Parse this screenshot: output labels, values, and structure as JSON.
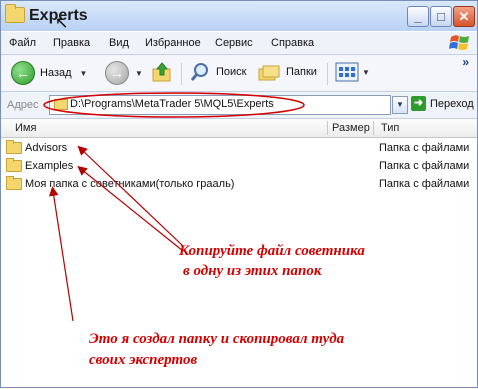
{
  "window": {
    "title": "Experts"
  },
  "menu": [
    "Файл",
    "Правка",
    "Вид",
    "Избранное",
    "Сервис",
    "Справка"
  ],
  "toolbar": {
    "back_label": "Назад",
    "search_label": "Поиск",
    "folders_label": "Папки"
  },
  "address": {
    "label": "Адрес",
    "value": "D:\\Programs\\MetaTrader 5\\MQL5\\Experts",
    "go_label": "Переход"
  },
  "columns": {
    "name": "Имя",
    "size": "Размер",
    "type": "Тип"
  },
  "files": [
    {
      "name": "Advisors",
      "type": "Папка с файлами"
    },
    {
      "name": "Examples",
      "type": "Папка с файлами"
    },
    {
      "name": "Моя папка с советниками(только грааль)",
      "type": "Папка с файлами"
    }
  ],
  "annotations": {
    "copy_line1": "Копируйте файл советника",
    "copy_line2": "в одну из этих папок",
    "created_line1": "Это я создал папку и скопировал туда",
    "created_line2": "своих экспертов"
  },
  "colors": {
    "annotation": "#d40000",
    "titlebar": "#b9d1f3",
    "folder": "#f3d66e"
  }
}
